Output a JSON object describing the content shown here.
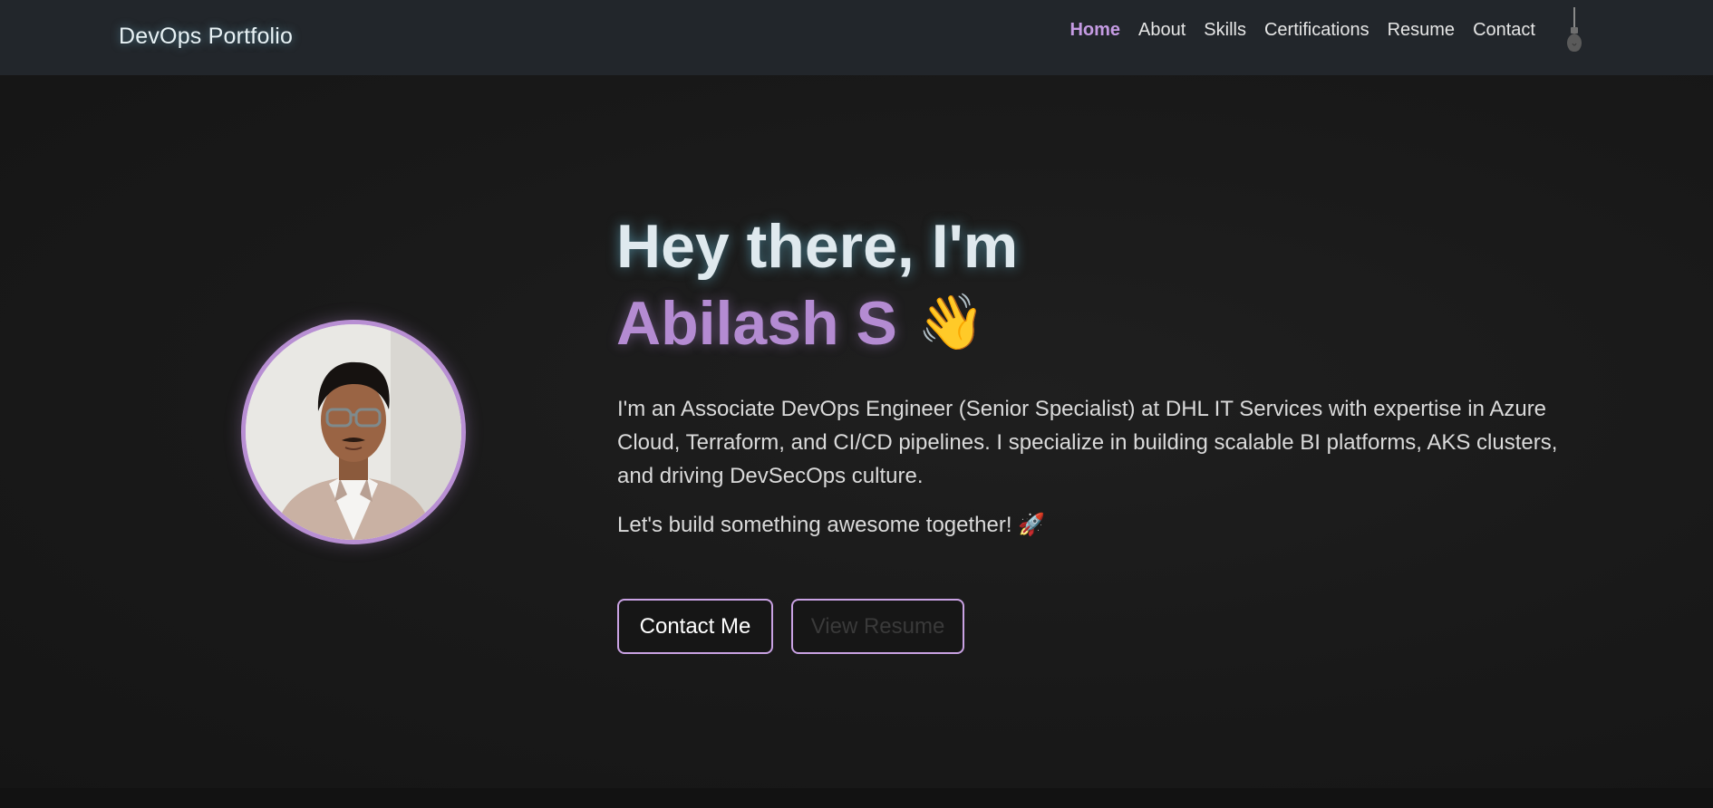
{
  "nav": {
    "brand": "DevOps Portfolio",
    "links": [
      "Home",
      "About",
      "Skills",
      "Certifications",
      "Resume",
      "Contact"
    ],
    "active": "Home",
    "theme_toggle_icon": "lightbulb-icon"
  },
  "hero": {
    "greeting": "Hey there, I'm",
    "name": "Abilash S",
    "wave_emoji": "👋",
    "bio": "I'm an Associate DevOps Engineer (Senior Specialist) at DHL IT Services with expertise in Azure Cloud, Terraform, and CI/CD pipelines. I specialize in building scalable BI platforms, AKS clusters, and driving DevSecOps culture.",
    "tagline": "Let's build something awesome together! 🚀",
    "buttons": {
      "contact": "Contact Me",
      "resume": "View Resume"
    }
  },
  "colors": {
    "accent": "#b48bd2",
    "nav_bg": "#22262b",
    "page_bg": "#181818"
  }
}
